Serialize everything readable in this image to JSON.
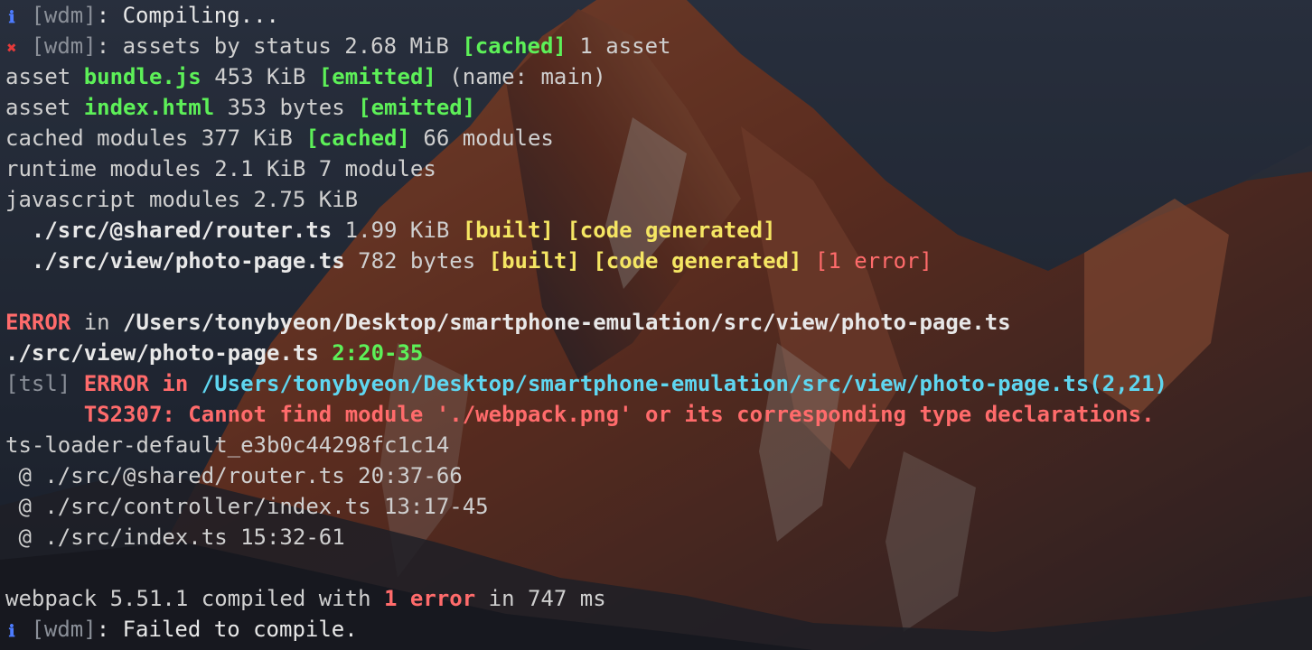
{
  "terminal": {
    "lines": [
      {
        "l0": "[wdm]",
        "l1": ": Compiling..."
      },
      {
        "l0": "[wdm]",
        "l1": ": assets by status 2.68 MiB ",
        "l2": "[cached]",
        "l3": " 1 asset"
      },
      {
        "l0": "asset ",
        "l1": "bundle.js",
        "l2": " 453 KiB ",
        "l3": "[emitted]",
        "l4": " (name: main)"
      },
      {
        "l0": "asset ",
        "l1": "index.html",
        "l2": " 353 bytes ",
        "l3": "[emitted]"
      },
      {
        "l0": "cached modules 377 KiB ",
        "l1": "[cached]",
        "l2": " 66 modules"
      },
      {
        "l0": "runtime modules 2.1 KiB 7 modules"
      },
      {
        "l0": "javascript modules 2.75 KiB"
      },
      {
        "l0": "  ./src/@shared/router.ts",
        "l1": " 1.99 KiB ",
        "l2": "[built]",
        "l3": " ",
        "l4": "[code generated]"
      },
      {
        "l0": "  ./src/view/photo-page.ts",
        "l1": " 782 bytes ",
        "l2": "[built]",
        "l3": " ",
        "l4": "[code generated]",
        "l5": " ",
        "l6": "[1 error]"
      },
      {
        "l0": ""
      },
      {
        "l0": "ERROR",
        "l1": " in ",
        "l2": "/Users/tonybyeon/Desktop/smartphone-emulation/src/view/photo-page.ts"
      },
      {
        "l0": "./src/view/photo-page.ts",
        "l1": " ",
        "l2": "2:20-35"
      },
      {
        "l0": "[tsl]",
        "l1": " ",
        "l2": "ERROR in ",
        "l3": "/Users/tonybyeon/Desktop/smartphone-emulation/src/view/photo-page.ts(2,21)"
      },
      {
        "l0": "      ",
        "l1": "TS2307: Cannot find module './webpack.png' or its corresponding type declarations."
      },
      {
        "l0": "ts-loader-default_e3b0c44298fc1c14"
      },
      {
        "l0": " @ ./src/@shared/router.ts 20:37-66"
      },
      {
        "l0": " @ ./src/controller/index.ts 13:17-45"
      },
      {
        "l0": " @ ./src/index.ts 15:32-61"
      },
      {
        "l0": ""
      },
      {
        "l0": "webpack 5.51.1 compiled with ",
        "l1": "1 error",
        "l2": " in 747 ms"
      },
      {
        "l0": "[wdm]",
        "l1": ": Failed to compile."
      }
    ]
  },
  "icons": {
    "info": "info-icon",
    "error": "error-x-icon"
  },
  "colors": {
    "accent_green": "#5df058",
    "accent_yellow": "#f5e663",
    "accent_red": "#ff6b6b",
    "accent_cyan": "#5fd6f0",
    "info_blue": "#4d7cff"
  }
}
